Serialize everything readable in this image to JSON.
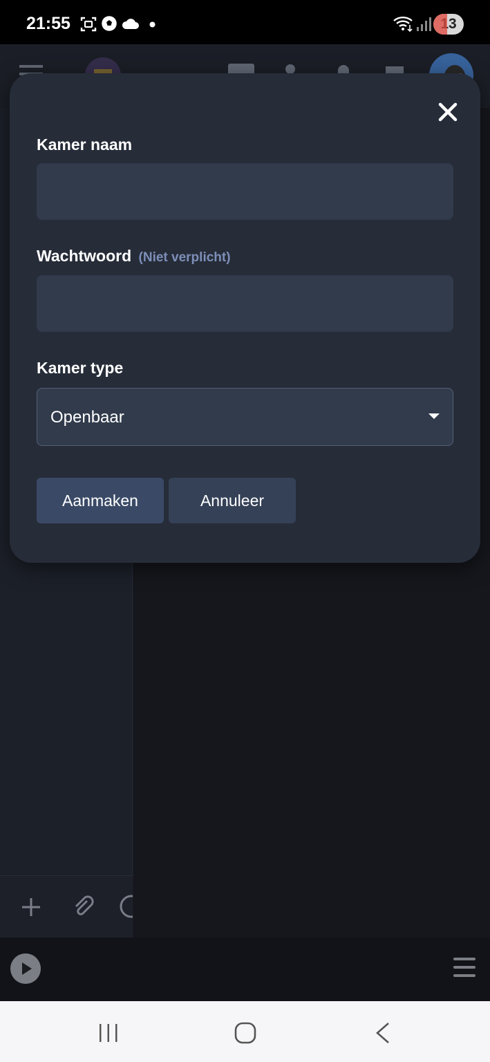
{
  "status_bar": {
    "time": "21:55",
    "notification_count": "13",
    "icons": [
      "screenshot-icon",
      "soccer-ball-icon",
      "cloud-icon",
      "dot-icon",
      "wifi-icon",
      "signal-icon"
    ]
  },
  "modal": {
    "room_name": {
      "label": "Kamer naam",
      "value": ""
    },
    "password": {
      "label": "Wachtwoord",
      "hint": "(Niet verplicht)",
      "value": ""
    },
    "room_type": {
      "label": "Kamer type",
      "selected": "Openbaar"
    },
    "buttons": {
      "create": "Aanmaken",
      "cancel": "Annuleer"
    }
  },
  "colors": {
    "modal_background": "#262c38",
    "input_background": "#313b4c",
    "hint_text": "#7d8fb8",
    "create_button": "#3a4a66",
    "cancel_button": "#354157"
  }
}
